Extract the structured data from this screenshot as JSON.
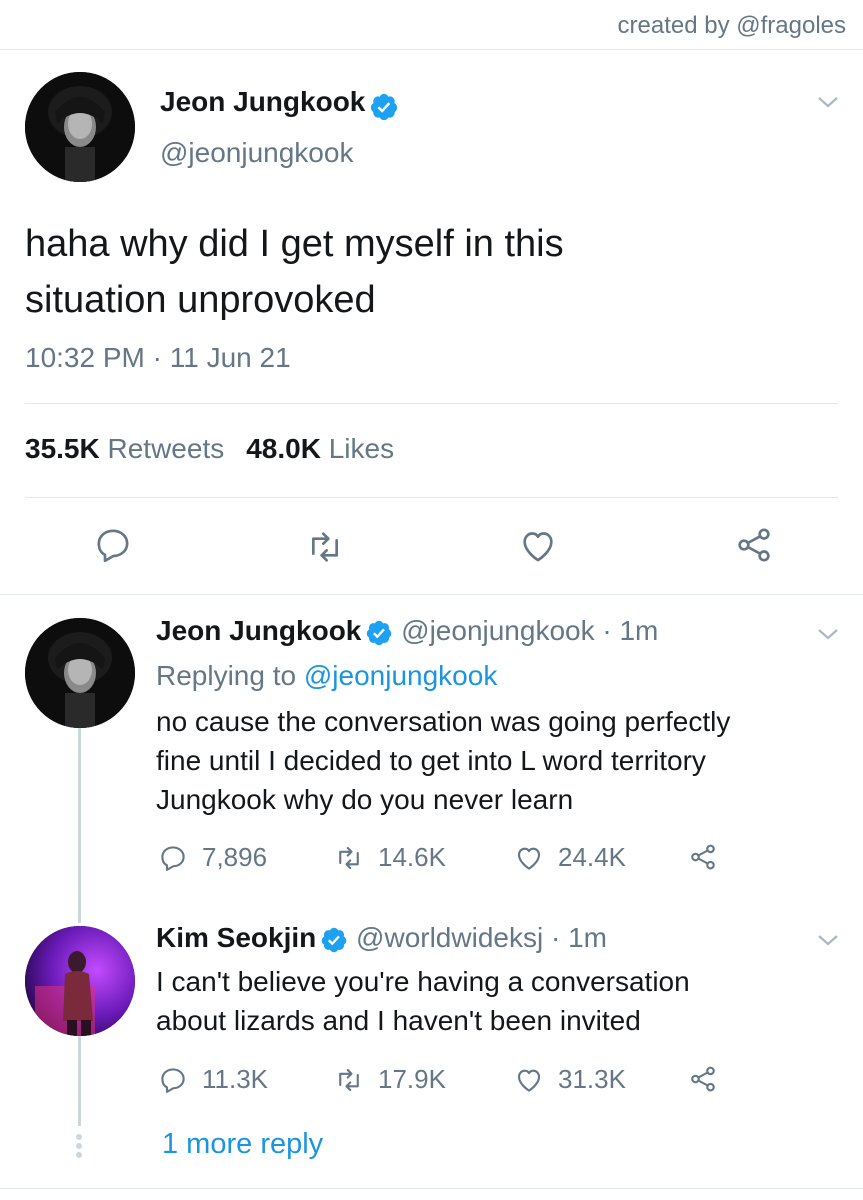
{
  "credit": "created by @fragoles",
  "main_tweet": {
    "name": "Jeon Jungkook",
    "handle": "@jeonjungkook",
    "text_line1": "haha why did I get myself in this",
    "text_line2": "situation unprovoked",
    "timestamp": "10:32 PM · 11 Jun 21",
    "retweets_count": "35.5K",
    "retweets_label": "Retweets",
    "likes_count": "48.0K",
    "likes_label": "Likes"
  },
  "replies": [
    {
      "name": "Jeon Jungkook",
      "handle": "@jeonjungkook · 1m",
      "replying_prefix": "Replying to",
      "replying_to": "@jeonjungkook",
      "lines": [
        "no cause the conversation was going perfectly",
        "fine until I decided to get into L word territory",
        "Jungkook why do you never learn"
      ],
      "reply_count": "7,896",
      "retweet_count": "14.6K",
      "like_count": "24.4K"
    },
    {
      "name": "Kim Seokjin",
      "handle": "@worldwideksj · 1m",
      "lines": [
        "I can't believe you're having a conversation",
        "about lizards and I haven't been invited"
      ],
      "reply_count": "11.3K",
      "retweet_count": "17.9K",
      "like_count": "31.3K"
    }
  ],
  "more_replies": "1 more reply",
  "colors": {
    "accent": "#1b95e0",
    "muted": "#657786",
    "divider": "#e1e8ed",
    "verified": "#1da1f2"
  },
  "icons": {
    "verified": "verified-badge-icon",
    "caret": "chevron-down-icon",
    "reply": "reply-icon",
    "retweet": "retweet-icon",
    "like": "heart-icon",
    "share": "share-icon"
  }
}
